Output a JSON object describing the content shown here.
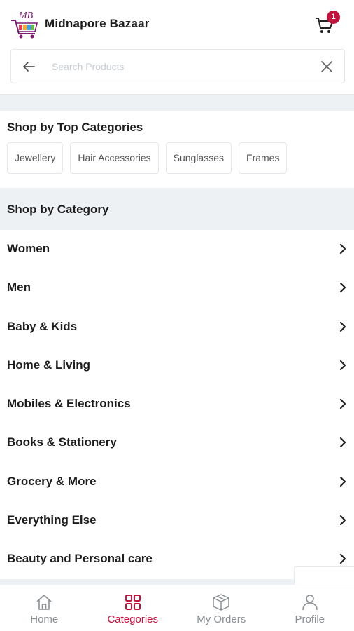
{
  "header": {
    "logo_text": "MB",
    "title": "Midnapore Bazaar",
    "cart_icon": "cart-icon",
    "cart_count": "1"
  },
  "search": {
    "placeholder": "Search Products",
    "value": "",
    "back_icon": "arrow-left-icon",
    "clear_icon": "close-icon"
  },
  "top_categories": {
    "title": "Shop by Top Categories",
    "chips": [
      "Jewellery",
      "Hair Accessories",
      "Sunglasses",
      "Frames"
    ]
  },
  "categories": {
    "title": "Shop by Category",
    "items": [
      "Women",
      "Men",
      "Baby & Kids",
      "Home & Living",
      "Mobiles & Electronics",
      "Books & Stationery",
      "Grocery & More",
      "Everything Else",
      "Beauty and Personal care"
    ]
  },
  "bottom_nav": {
    "items": [
      {
        "label": "Home",
        "icon": "home-icon",
        "active": false
      },
      {
        "label": "Categories",
        "icon": "grid-icon",
        "active": true
      },
      {
        "label": "My Orders",
        "icon": "package-icon",
        "active": false
      },
      {
        "label": "Profile",
        "icon": "user-icon",
        "active": false
      }
    ]
  },
  "colors": {
    "accent": "#c0143c",
    "band": "#eef1f4",
    "text": "#1d1d1d",
    "muted": "#8a8f94"
  }
}
